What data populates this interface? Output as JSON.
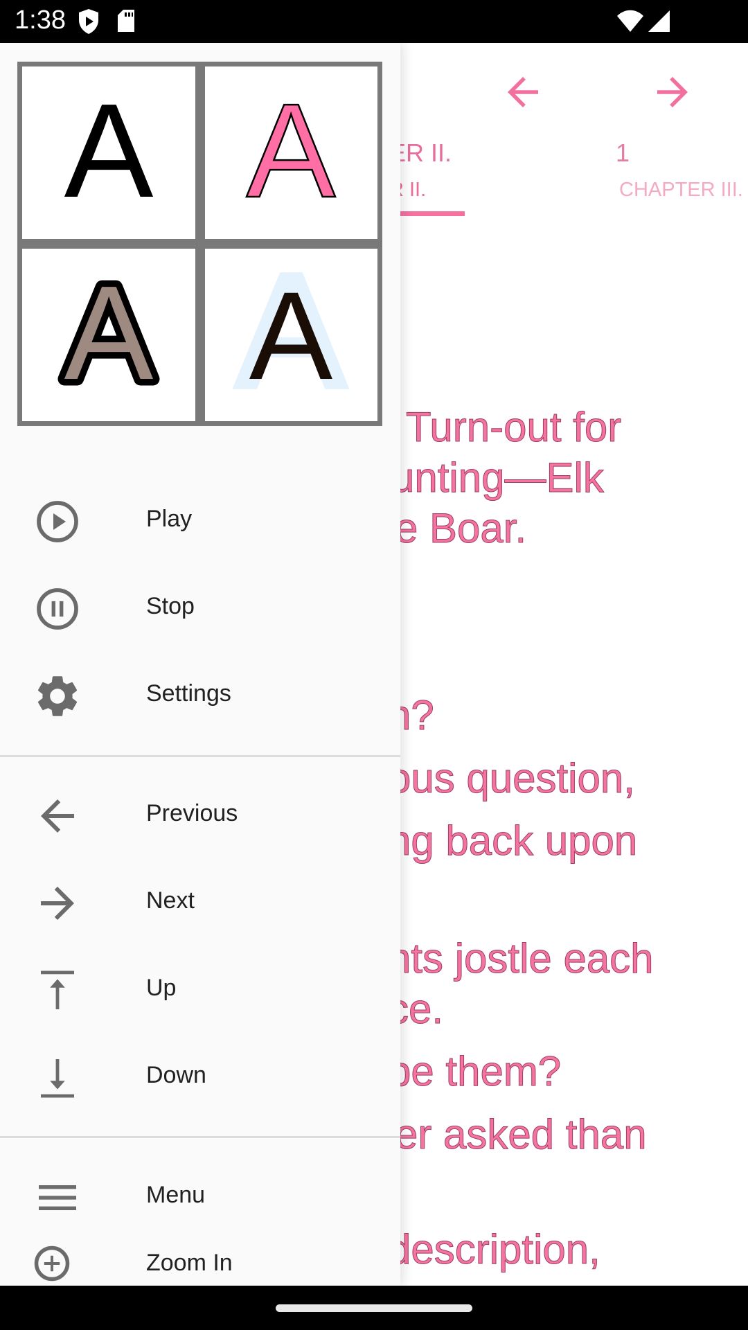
{
  "status_bar": {
    "time": "1:38",
    "left_icons": [
      "play-protect-shield-icon",
      "sd-card-icon"
    ],
    "right_icons": [
      "wifi-icon",
      "cell-signal-icon"
    ]
  },
  "reader": {
    "toolbar": {
      "prev_icon": "arrow-left-icon",
      "next_icon": "arrow-right-icon"
    },
    "tabs": [
      {
        "number": "ER II.",
        "name": "R II.",
        "selected": true
      },
      {
        "number": "1",
        "name": "CHAPTER III.",
        "selected": false
      }
    ],
    "accent_color": "#f06a9a",
    "visible_text_lines": [
      "Turn-out for",
      "unting—Elk",
      "e Boar.",
      "n?",
      "ous question,",
      "ng back upon",
      "nts jostle each",
      "ce.",
      "be them?",
      "er asked than",
      "description,"
    ]
  },
  "drawer": {
    "style_options": [
      {
        "name": "plain-black",
        "glyph": "A",
        "fill": "#000000"
      },
      {
        "name": "pink-outlined",
        "glyph": "A",
        "fill": "#ff6fa6",
        "stroke": "#000000"
      },
      {
        "name": "brown-thick-outline",
        "glyph": "A",
        "fill": "#9e8a80",
        "stroke": "#000000"
      },
      {
        "name": "dark-light-blue-halo",
        "glyph": "A",
        "fill": "#1a0d06",
        "halo": "#e3f2fd"
      }
    ],
    "groups": [
      [
        {
          "id": "play",
          "label": "Play",
          "icon": "play-circle-icon"
        },
        {
          "id": "stop",
          "label": "Stop",
          "icon": "pause-circle-icon"
        },
        {
          "id": "settings",
          "label": "Settings",
          "icon": "gear-icon"
        }
      ],
      [
        {
          "id": "previous",
          "label": "Previous",
          "icon": "arrow-left-icon"
        },
        {
          "id": "next",
          "label": "Next",
          "icon": "arrow-right-icon"
        },
        {
          "id": "up",
          "label": "Up",
          "icon": "arrow-up-to-top-icon"
        },
        {
          "id": "down",
          "label": "Down",
          "icon": "arrow-down-to-bottom-icon"
        }
      ],
      [
        {
          "id": "menu",
          "label": "Menu",
          "icon": "hamburger-menu-icon"
        },
        {
          "id": "zoom-in",
          "label": "Zoom In",
          "icon": "zoom-in-icon"
        }
      ]
    ]
  }
}
